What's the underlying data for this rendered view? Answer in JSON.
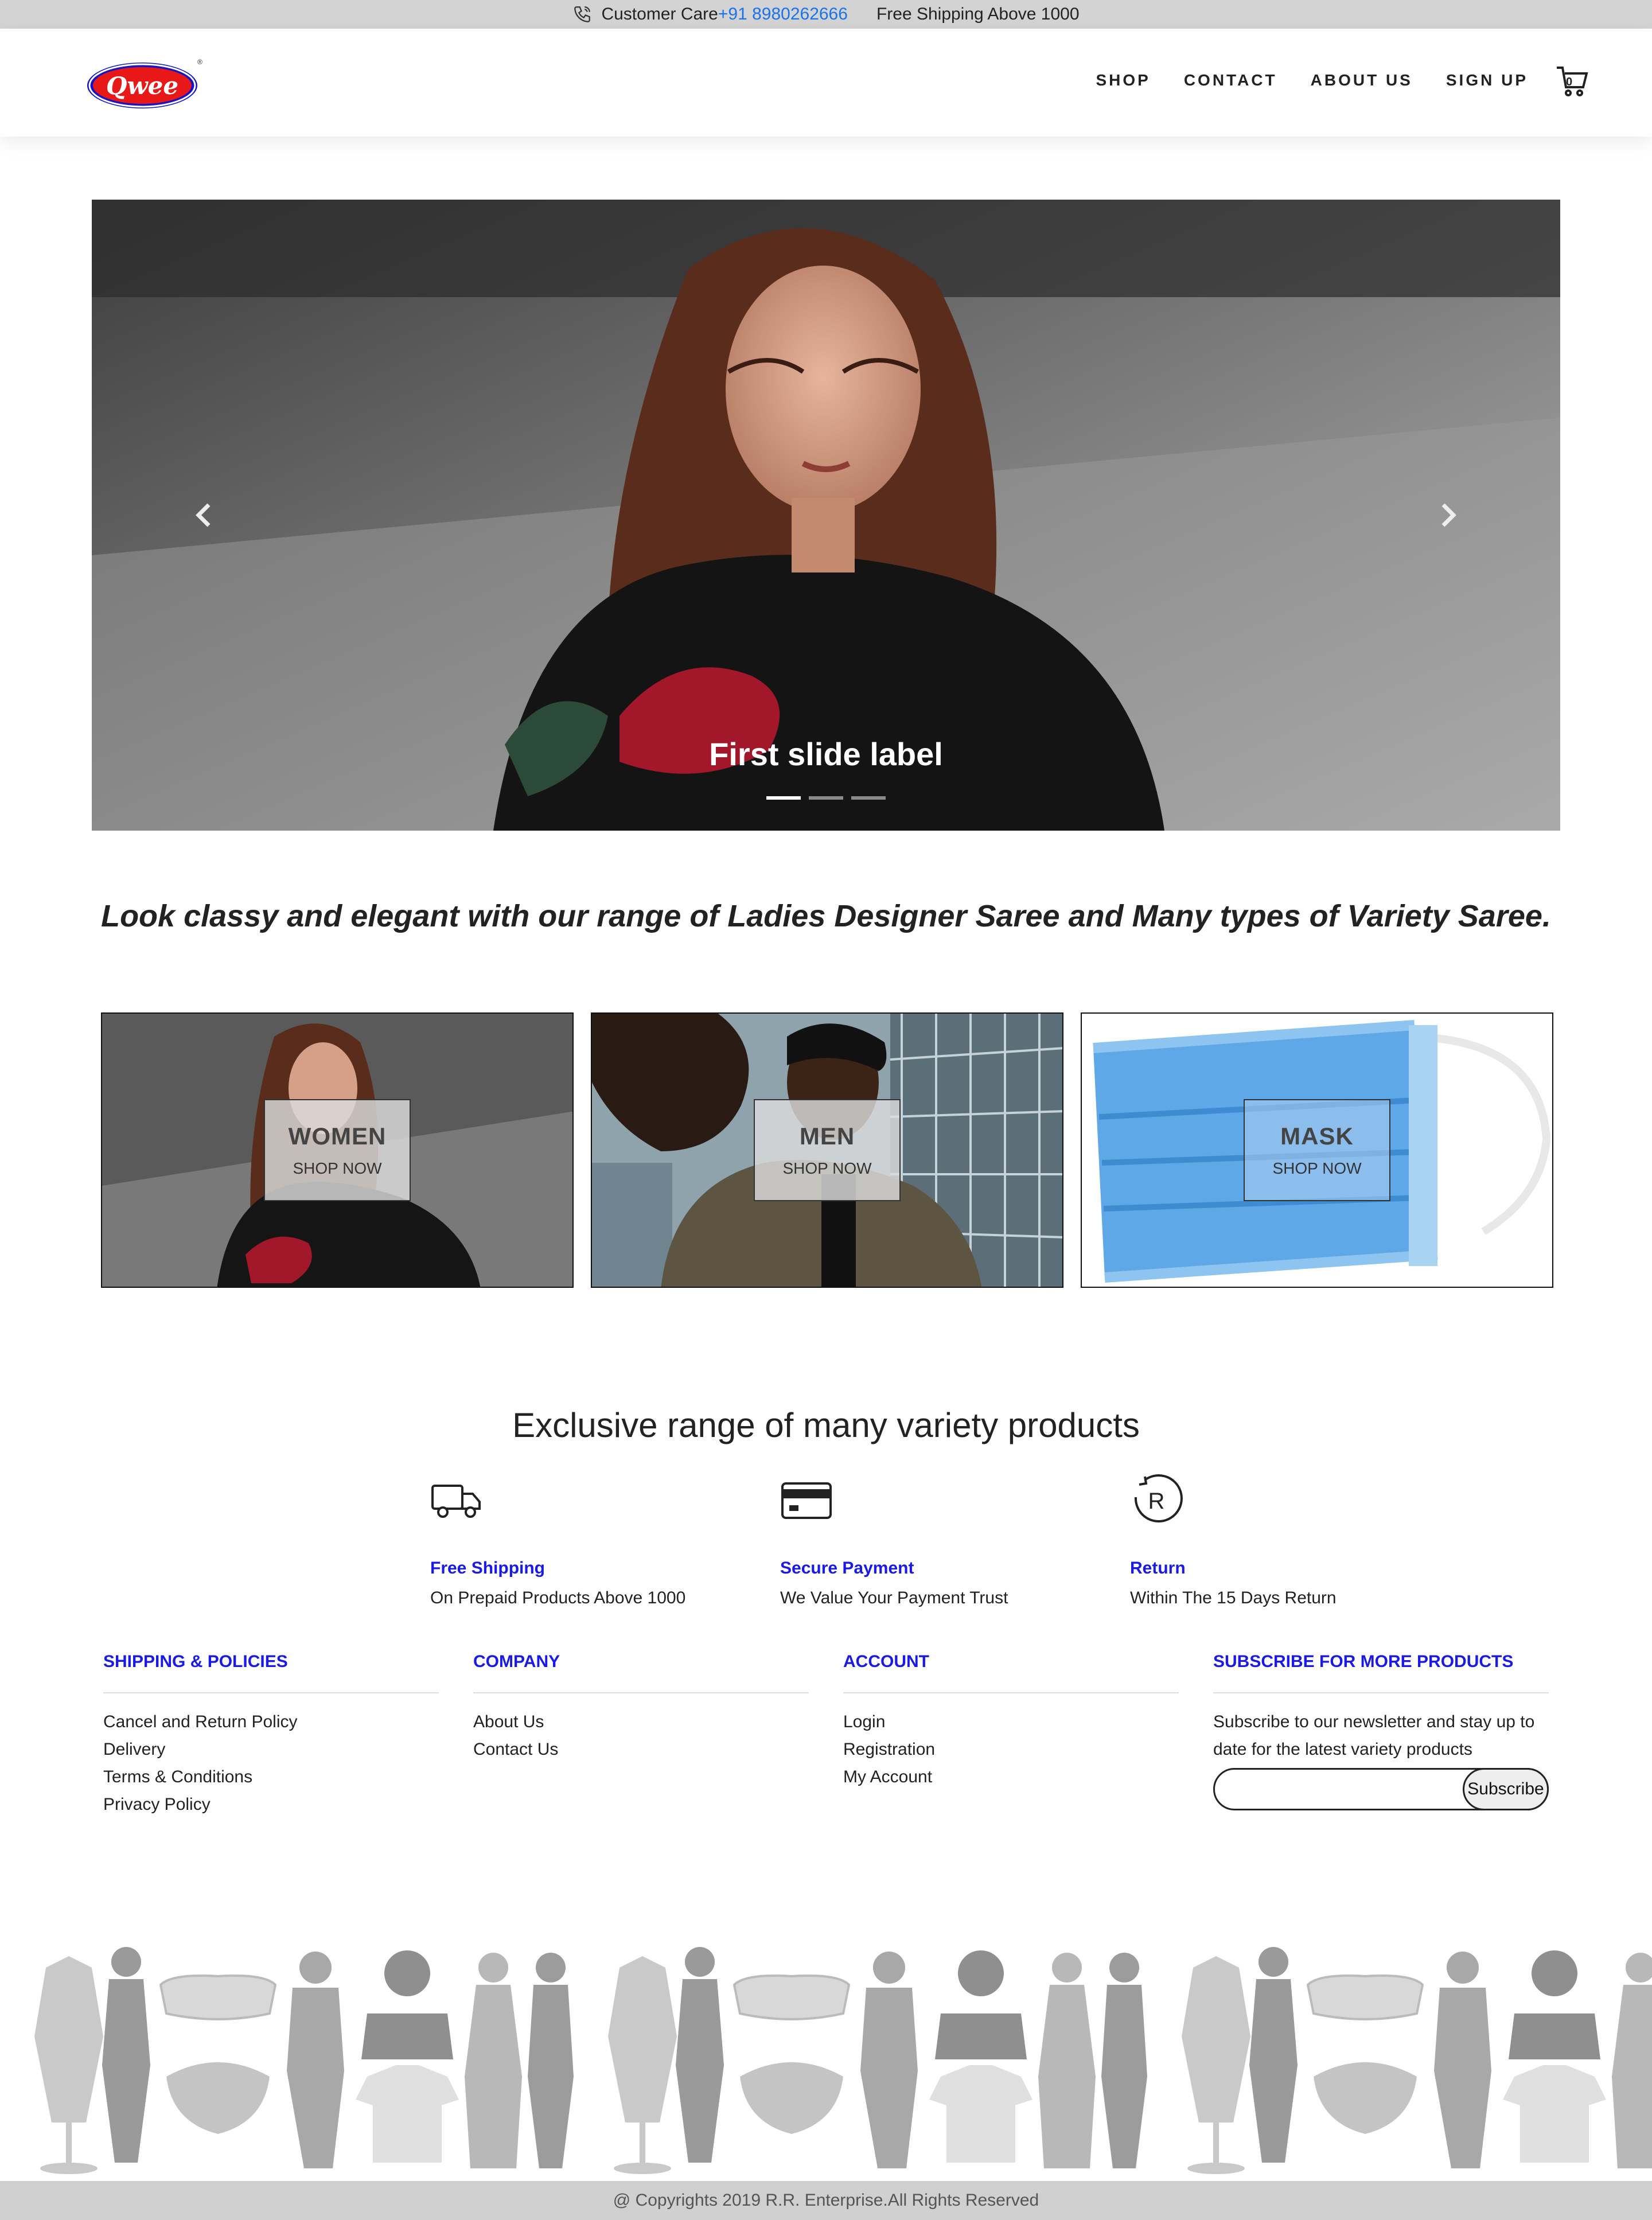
{
  "topbar": {
    "customer_care_label": "Customer Care",
    "phone": "+91 8980262666",
    "shipping_note": "Free Shipping Above 1000"
  },
  "header": {
    "logo_text": "Qwee",
    "nav": [
      "SHOP",
      "CONTACT",
      "ABOUT US",
      "SIGN UP"
    ],
    "cart_count": "0"
  },
  "carousel": {
    "caption": "First slide label",
    "slide_count": 3,
    "active_index": 0
  },
  "tagline": "Look classy and elegant with our range of Ladies Designer Saree and Many types of Variety Saree.",
  "categories": [
    {
      "title": "WOMEN",
      "cta": "SHOP NOW"
    },
    {
      "title": "MEN",
      "cta": "SHOP NOW"
    },
    {
      "title": "MASK",
      "cta": "SHOP NOW"
    }
  ],
  "features": {
    "title": "Exclusive range of many variety products",
    "items": [
      {
        "icon": "truck-icon",
        "title": "Free Shipping",
        "subtitle": "On Prepaid Products Above 1000"
      },
      {
        "icon": "credit-card-icon",
        "title": "Secure Payment",
        "subtitle": "We Value Your Payment Trust"
      },
      {
        "icon": "return-icon",
        "title": "Return",
        "subtitle": "Within The 15 Days Return"
      }
    ]
  },
  "footer": {
    "shipping": {
      "heading": "SHIPPING & POLICIES",
      "links": [
        "Cancel and Return Policy",
        "Delivery",
        "Terms & Conditions",
        "Privacy Policy"
      ]
    },
    "company": {
      "heading": "COMPANY",
      "links": [
        "About Us",
        "Contact Us"
      ]
    },
    "account": {
      "heading": "ACCOUNT",
      "links": [
        "Login",
        "Registration",
        "My Account"
      ]
    },
    "subscribe": {
      "heading": "SUBSCRIBE FOR MORE PRODUCTS",
      "text": "Subscribe to our newsletter and stay up to date for the latest variety products",
      "button": "Subscribe",
      "input_value": ""
    }
  },
  "copyright": "@ Copyrights 2019 R.R. Enterprise.All Rights Reserved",
  "colors": {
    "accent_blue": "#1a1ae6",
    "phone_blue": "#1a73e8",
    "topbar_gray": "#d3d3d3"
  }
}
